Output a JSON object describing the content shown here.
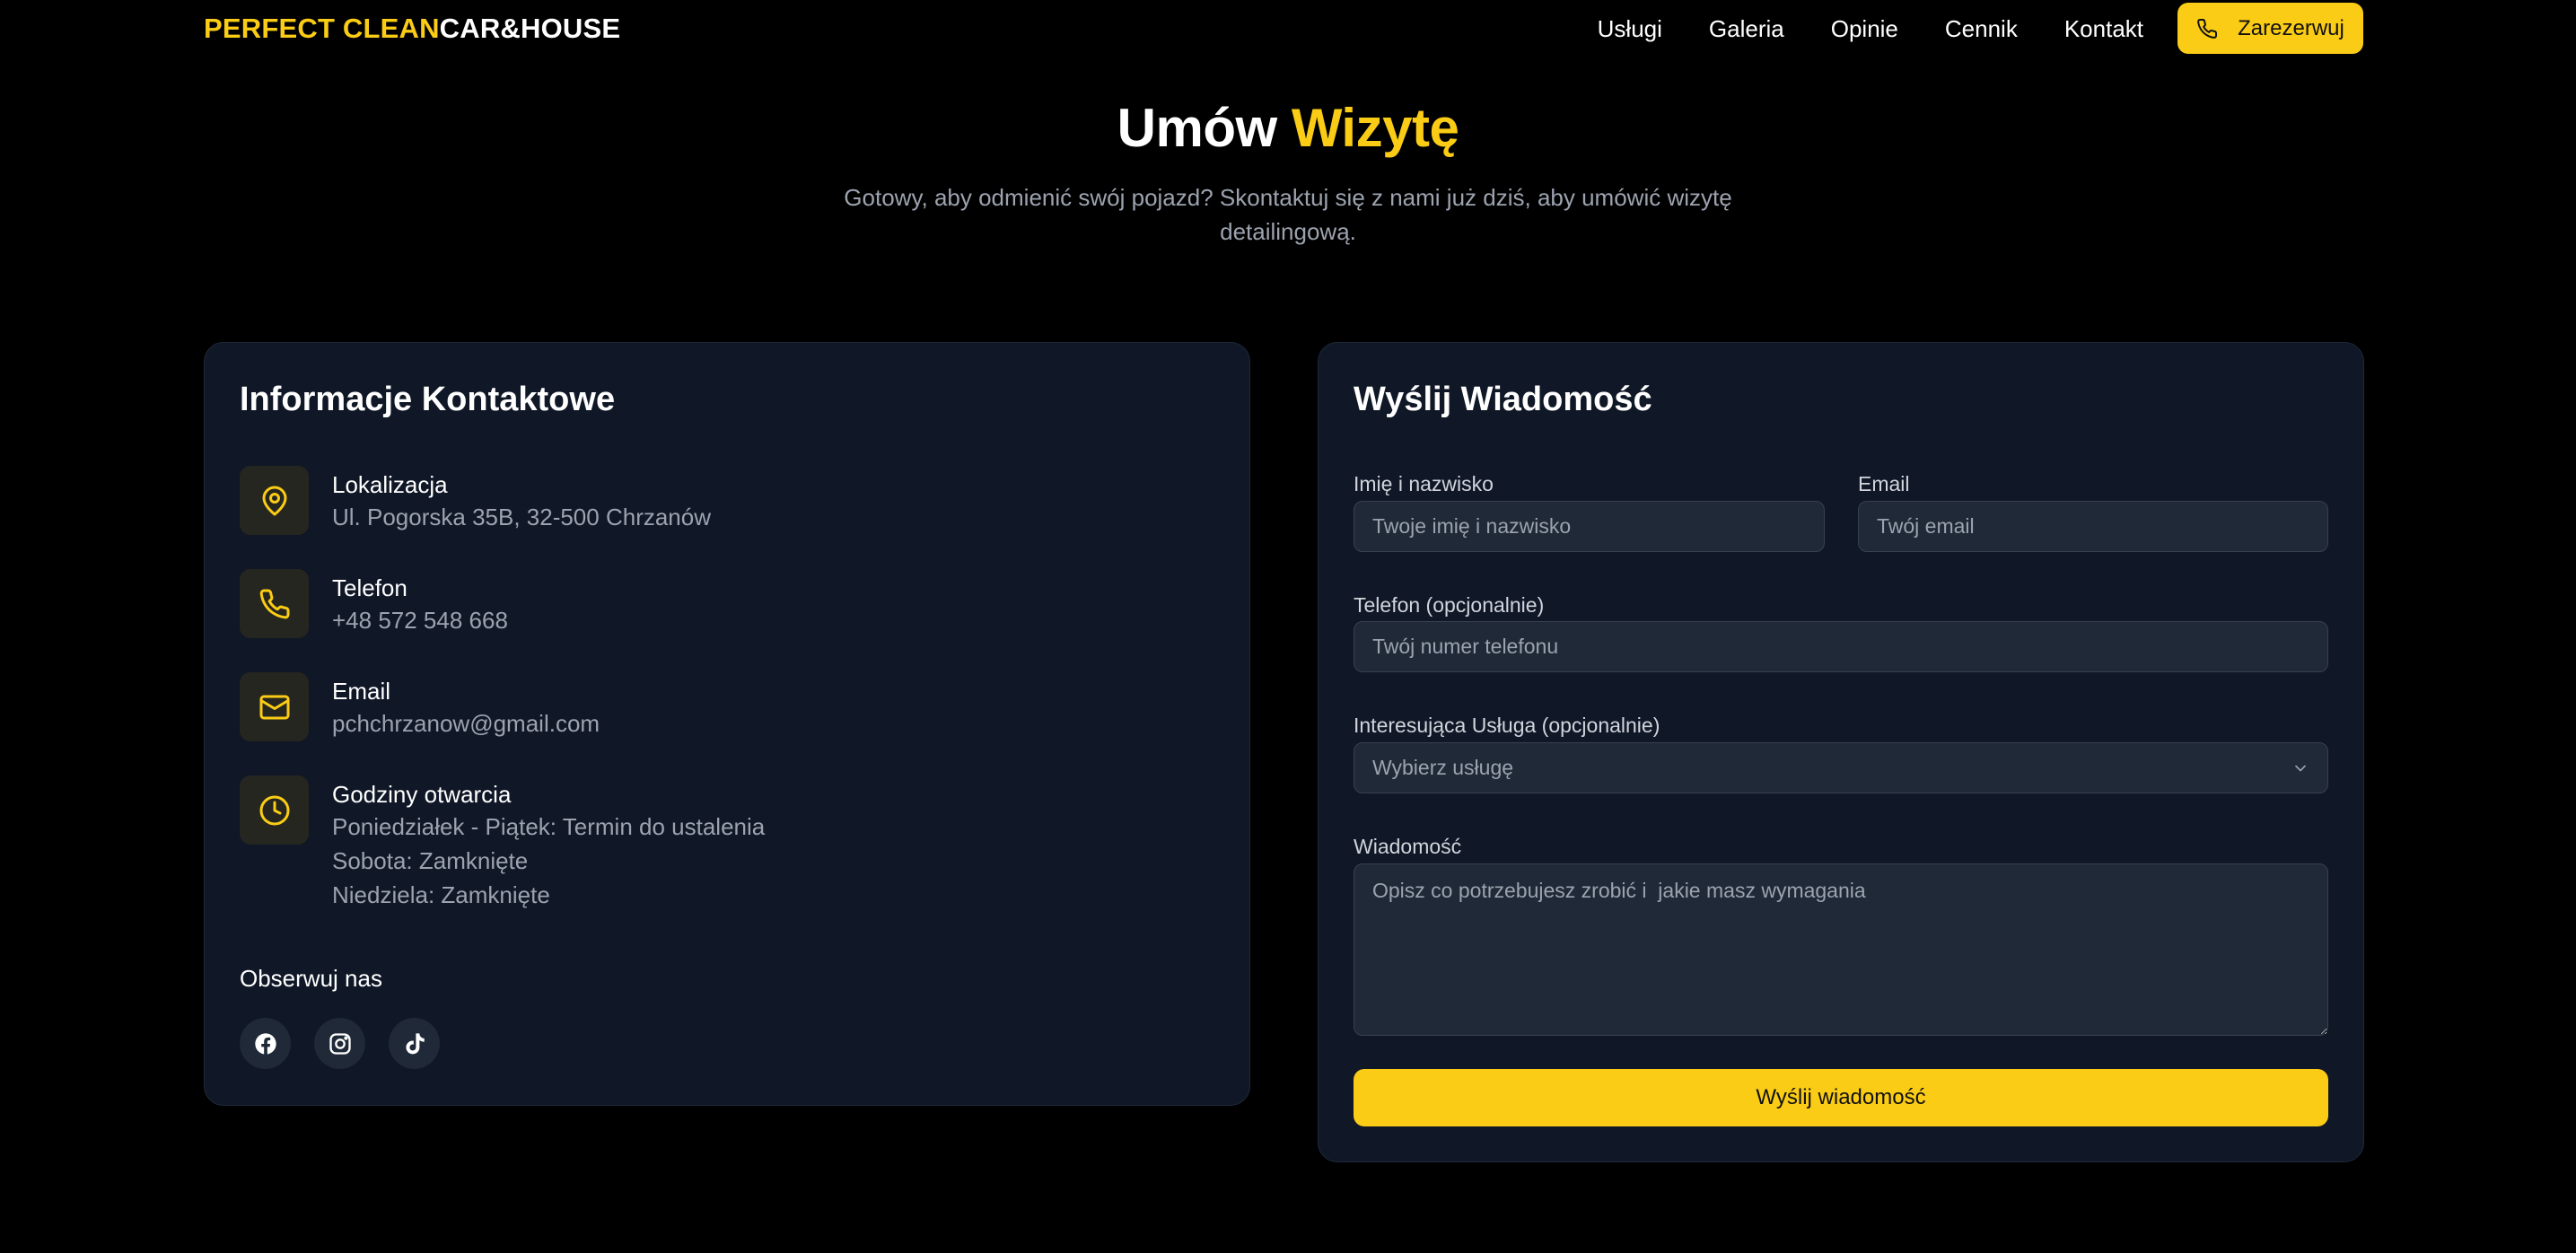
{
  "nav": {
    "logo_accent": "PERFECT CLEAN",
    "logo_rest": "CAR&HOUSE",
    "links": [
      "Usługi",
      "Galeria",
      "Opinie",
      "Cennik",
      "Kontakt"
    ],
    "book_label": "Zarezerwuj"
  },
  "hero": {
    "title_start": "Umów",
    "title_accent": "Wizytę",
    "subtitle": "Gotowy, aby odmienić swój pojazd? Skontaktuj się z nami już dziś, aby umówić wizytę detailingową."
  },
  "contact": {
    "title": "Informacje Kontaktowe",
    "location": {
      "label": "Lokalizacja",
      "value": "Ul. Pogorska 35B, 32-500 Chrzanów",
      "icon": "map-pin-icon"
    },
    "phone": {
      "label": "Telefon",
      "value": "+48 572 548 668",
      "icon": "phone-icon"
    },
    "email": {
      "label": "Email",
      "value": "pchchrzanow@gmail.com",
      "icon": "mail-icon"
    },
    "hours": {
      "label": "Godziny otwarcia",
      "icon": "clock-icon",
      "lines": [
        "Poniedziałek - Piątek: Termin do ustalenia",
        "Sobota: Zamknięte",
        "Niedziela: Zamknięte"
      ]
    },
    "follow_label": "Obserwuj nas",
    "socials": [
      "facebook-icon",
      "instagram-icon",
      "tiktok-icon"
    ]
  },
  "form": {
    "title": "Wyślij Wiadomość",
    "name_label": "Imię i nazwisko",
    "name_placeholder": "Twoje imię i nazwisko",
    "email_label": "Email",
    "email_placeholder": "Twój email",
    "phone_label": "Telefon (opcjonalnie)",
    "phone_placeholder": "Twój numer telefonu",
    "service_label": "Interesująca Usługa (opcjonalnie)",
    "service_selected": "Wybierz usługę",
    "message_label": "Wiadomość",
    "message_placeholder": "Opisz co potrzebujesz zrobić i  jakie masz wymagania",
    "submit_label": "Wyślij wiadomość"
  },
  "colors": {
    "accent": "#facc15",
    "background": "#000000",
    "card": "#101727",
    "input": "#1f2937",
    "muted_text": "#9ca3af"
  }
}
